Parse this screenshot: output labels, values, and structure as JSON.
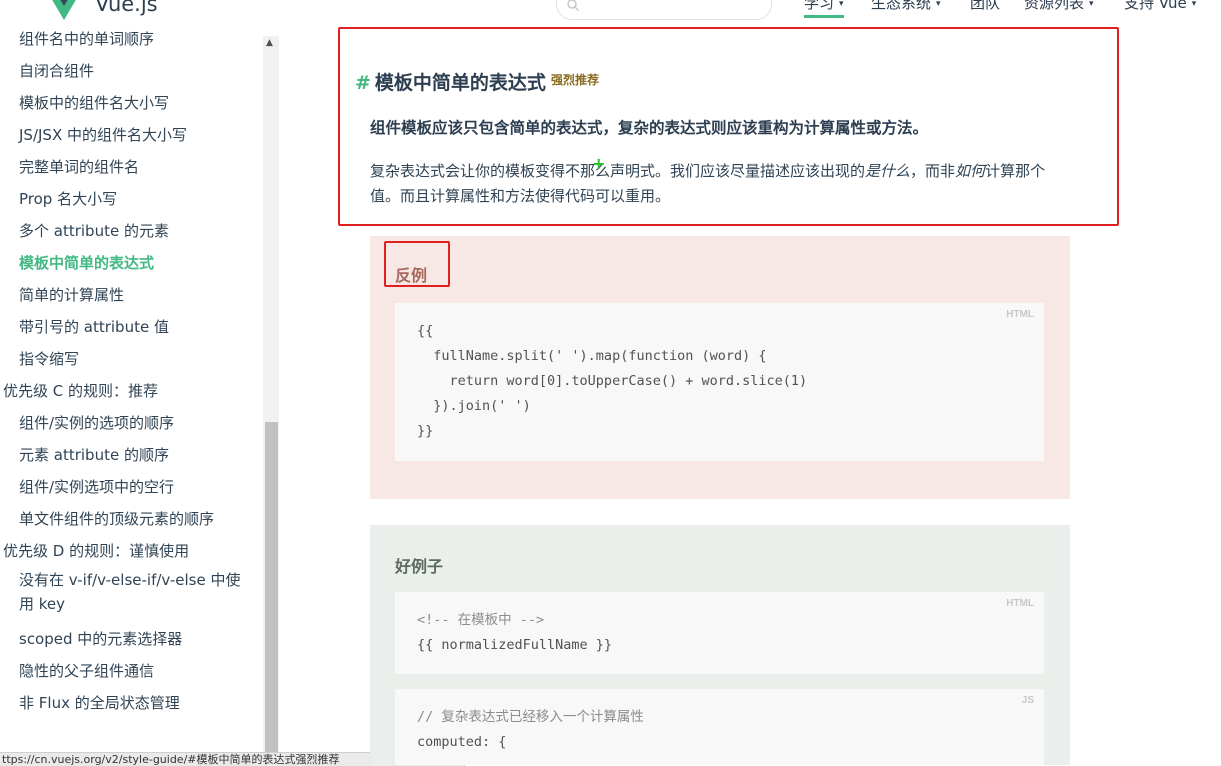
{
  "header": {
    "brand": "Vue.js",
    "search_placeholder": "",
    "nav": [
      {
        "label": "学习",
        "caret": "▾"
      },
      {
        "label": "生态系统",
        "caret": "▾"
      },
      {
        "label": "团队",
        "caret": ""
      },
      {
        "label": "资源列表",
        "caret": "▾"
      },
      {
        "label": "支持 Vue",
        "caret": "▾"
      }
    ],
    "accent_color": "#42b983"
  },
  "sidebar": {
    "items": [
      {
        "label": "组件名中的单词顺序",
        "level": 2
      },
      {
        "label": "自闭合组件",
        "level": 2
      },
      {
        "label": "模板中的组件名大小写",
        "level": 2
      },
      {
        "label": "JS/JSX 中的组件名大小写",
        "level": 2
      },
      {
        "label": "完整单词的组件名",
        "level": 2
      },
      {
        "label": "Prop 名大小写",
        "level": 2
      },
      {
        "label": "多个 attribute 的元素",
        "level": 2
      },
      {
        "label": "模板中简单的表达式",
        "level": 2,
        "active": true
      },
      {
        "label": "简单的计算属性",
        "level": 2
      },
      {
        "label": "带引号的 attribute 值",
        "level": 2
      },
      {
        "label": "指令缩写",
        "level": 2
      },
      {
        "label": "优先级 C 的规则：推荐",
        "level": 1
      },
      {
        "label": "组件/实例的选项的顺序",
        "level": 2
      },
      {
        "label": "元素 attribute 的顺序",
        "level": 2
      },
      {
        "label": "组件/实例选项中的空行",
        "level": 2
      },
      {
        "label": "单文件组件的顶级元素的顺序",
        "level": 2
      },
      {
        "label": "优先级 D 的规则：谨慎使用",
        "level": 1
      },
      {
        "label": "没有在 v-if/v-else-if/v-else 中使用 key",
        "level": 2
      },
      {
        "label": "scoped 中的元素选择器",
        "level": 2
      },
      {
        "label": "隐性的父子组件通信",
        "level": 2
      },
      {
        "label": "非 Flux 的全局状态管理",
        "level": 2
      }
    ]
  },
  "status_bar": {
    "url": "ttps://cn.vuejs.org/v2/style-guide/#模板中简单的表达式强烈推荐"
  },
  "main": {
    "section": {
      "hash": "#",
      "title": "模板中简单的表达式",
      "badge": "强烈推荐",
      "lead": "组件模板应该只包含简单的表达式，复杂的表达式则应该重构为计算属性或方法。",
      "para_part1": "复杂表达式会让你的模板变得不那么声明式。我们应该尽量描述应该出现的",
      "para_em1": "是什么",
      "para_part2": "，而非",
      "para_em2": "如何",
      "para_part3": "计算那个值。而且计算属性和方法使得代码可以重用。"
    },
    "bad_example": {
      "label": "反例",
      "lang": "HTML",
      "code": "{{\n  fullName.split(' ').map(function (word) {\n    return word[0].toUpperCase() + word.slice(1)\n  }).join(' ')\n}}"
    },
    "good_example": {
      "label": "好例子",
      "html_lang": "HTML",
      "html_comment": "<!-- 在模板中 -->",
      "html_code": "{{ normalizedFullName }}",
      "js_lang": "JS",
      "js_comment": "// 复杂表达式已经移入一个计算属性",
      "js_code": "computed: {"
    },
    "colors": {
      "bad_bg": "#f7e8e5",
      "good_bg": "#ebefeb",
      "highlight_border": "#e02020"
    }
  }
}
